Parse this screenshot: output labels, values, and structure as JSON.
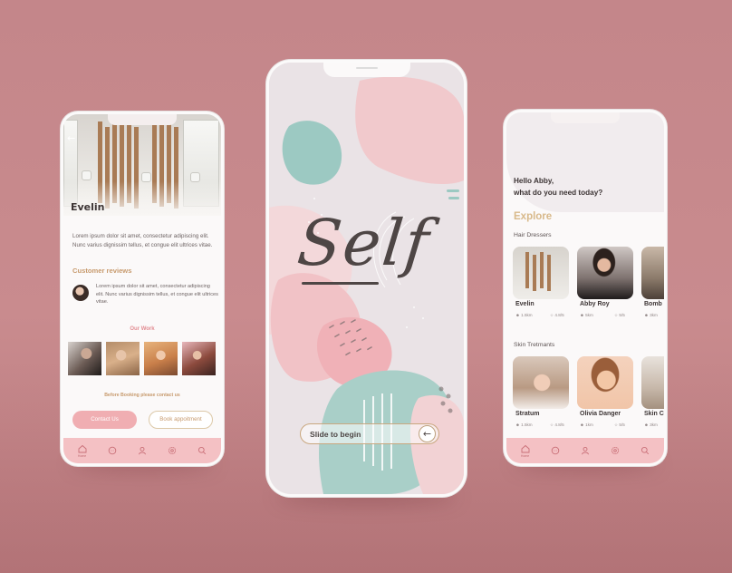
{
  "colors": {
    "background": "#c4868a",
    "accent_pink": "#f0aeb2",
    "accent_gold": "#c79a6d",
    "text_dark": "#3d3535",
    "tab_bar": "#f4c1c4"
  },
  "left_phone": {
    "back_icon": "back-arrow-icon",
    "salon_name": "Evelin",
    "description": "Lorem ipsum dolor sit amet, consectetur adipiscing elit. Nunc varius dignissim tellus, et congue elit ultrices vitae.",
    "reviews_heading": "Customer reviews",
    "review_text": "Lorem ipsum dolor sit amet, consectetur adipiscing elit. Nunc varius dignissim tellus, et congue elit ultrices vitae.",
    "work_heading": "Our Work",
    "booking_note": "Before Booking please contact us",
    "contact_button": "Contact Us",
    "book_button": "Book appoitment",
    "tabs": [
      {
        "icon": "home-icon",
        "label": "Home"
      },
      {
        "icon": "chat-icon",
        "label": ""
      },
      {
        "icon": "user-icon",
        "label": ""
      },
      {
        "icon": "settings-icon",
        "label": ""
      },
      {
        "icon": "search-icon",
        "label": ""
      }
    ]
  },
  "center_phone": {
    "logo": "Self",
    "slide_label": "Slide to begin",
    "slide_icon": "arrow-left-icon"
  },
  "right_phone": {
    "greeting_line1": "Hello Abby,",
    "greeting_line2": "what do you need today?",
    "explore": "Explore",
    "hair_section": "Hair Dressers",
    "hair_cards": [
      {
        "name": "Evelin",
        "distance": "1.5km",
        "rating": "4.8/5"
      },
      {
        "name": "Abby Roy",
        "distance": "5km",
        "rating": "5/5"
      },
      {
        "name": "Bomb",
        "distance": "3km",
        "rating": ""
      }
    ],
    "skin_section": "Skin Tretmants",
    "skin_cards": [
      {
        "name": "Stratum",
        "distance": "1.5km",
        "rating": "4.8/5"
      },
      {
        "name": "Olivia Danger",
        "distance": "1km",
        "rating": "5/5"
      },
      {
        "name": "Skin C",
        "distance": "3km",
        "rating": ""
      }
    ],
    "tabs": [
      {
        "icon": "home-icon",
        "label": "Home"
      },
      {
        "icon": "chat-icon",
        "label": ""
      },
      {
        "icon": "user-icon",
        "label": ""
      },
      {
        "icon": "settings-icon",
        "label": ""
      },
      {
        "icon": "search-icon",
        "label": ""
      }
    ]
  }
}
